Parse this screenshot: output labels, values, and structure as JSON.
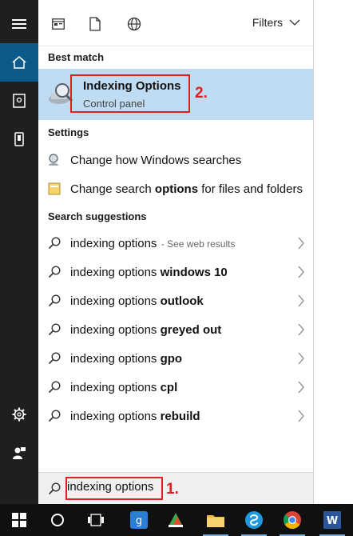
{
  "rail": {
    "items": [
      "menu-icon",
      "home-icon",
      "documents-icon",
      "mobile-icon",
      "settings-icon",
      "feedback-icon"
    ]
  },
  "toolbar": {
    "filters_label": "Filters",
    "icons": [
      "apps-filter-icon",
      "documents-filter-icon",
      "web-filter-icon"
    ]
  },
  "best_match": {
    "heading": "Best match",
    "title": "Indexing Options",
    "subtitle": "Control panel",
    "annotation": "2."
  },
  "settings": {
    "heading": "Settings",
    "items": [
      {
        "prefix": "Change how Windows searches",
        "bold": "",
        "suffix": ""
      },
      {
        "prefix": "Change search ",
        "bold": "options",
        "suffix": " for files and folders"
      }
    ]
  },
  "suggestions": {
    "heading": "Search suggestions",
    "items": [
      {
        "query": "indexing options",
        "bold": "",
        "hint": " - See web results"
      },
      {
        "query": "indexing options ",
        "bold": "windows 10",
        "hint": ""
      },
      {
        "query": "indexing options ",
        "bold": "outlook",
        "hint": ""
      },
      {
        "query": "indexing options ",
        "bold": "greyed out",
        "hint": ""
      },
      {
        "query": "indexing options ",
        "bold": "gpo",
        "hint": ""
      },
      {
        "query": "indexing options ",
        "bold": "cpl",
        "hint": ""
      },
      {
        "query": "indexing options ",
        "bold": "rebuild",
        "hint": ""
      }
    ]
  },
  "search": {
    "value": "indexing options",
    "annotation": "1."
  },
  "taskbar": {
    "items": [
      "windows-start-icon",
      "cortana-icon",
      "task-view-icon",
      "app-icon",
      "app-icon-2",
      "file-explorer-icon",
      "skype-icon",
      "chrome-icon",
      "word-icon"
    ]
  },
  "colors": {
    "accent": "#0b5a8a",
    "selection": "#bfdcf2",
    "annotation": "#e02020"
  }
}
